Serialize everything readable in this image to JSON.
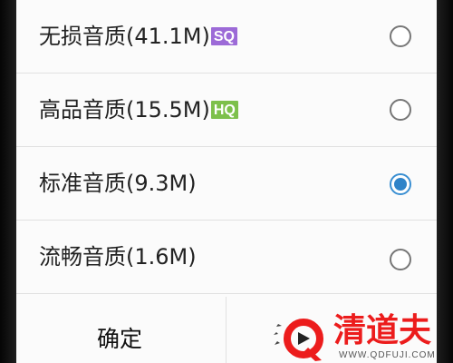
{
  "quality_options": [
    {
      "label": "无损音质(41.1M)",
      "badge": "SQ",
      "badge_color": "#9c6ad7",
      "selected": false
    },
    {
      "label": "高品音质(15.5M)",
      "badge": "HQ",
      "badge_color": "#7dc04b",
      "selected": false
    },
    {
      "label": "标准音质(9.3M)",
      "badge": "",
      "selected": true
    },
    {
      "label": "流畅音质(1.6M)",
      "badge": "",
      "selected": false
    }
  ],
  "footer": {
    "confirm_label": "确定"
  },
  "watermark": {
    "name": "清道夫",
    "url": "WWW.QDFUJI.COM"
  },
  "colors": {
    "selected_radio": "#2f83c8",
    "watermark_red": "#ec1c1c"
  }
}
